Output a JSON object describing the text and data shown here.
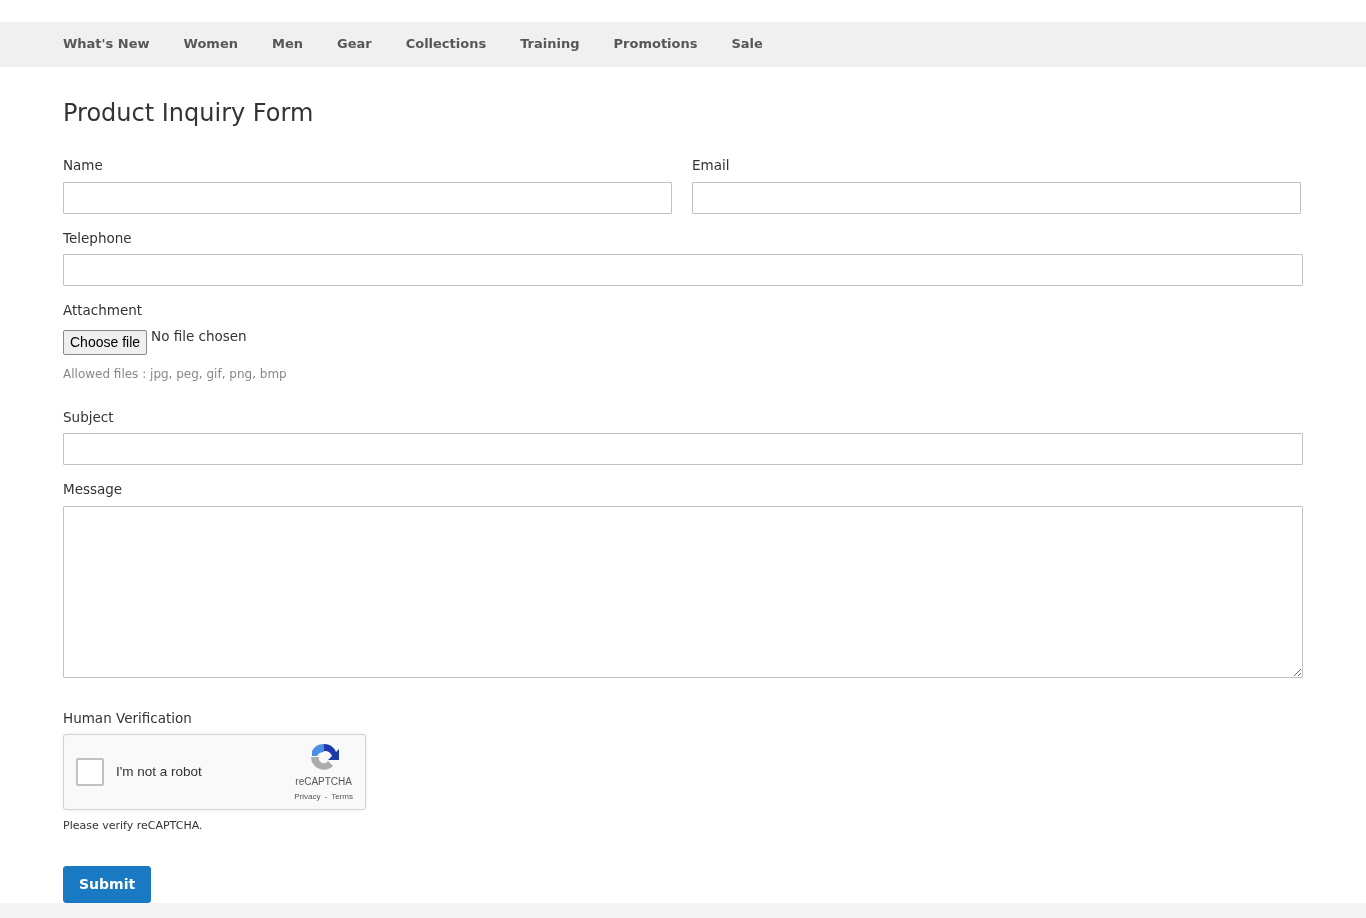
{
  "nav": {
    "items": [
      {
        "label": "What's New"
      },
      {
        "label": "Women"
      },
      {
        "label": "Men"
      },
      {
        "label": "Gear"
      },
      {
        "label": "Collections"
      },
      {
        "label": "Training"
      },
      {
        "label": "Promotions"
      },
      {
        "label": "Sale"
      }
    ]
  },
  "page_title": "Product Inquiry Form",
  "form": {
    "fields": [
      {
        "kind": "text",
        "label": "Name",
        "half": true
      },
      {
        "kind": "text",
        "label": "Email",
        "half": true
      },
      {
        "kind": "text",
        "label": "Telephone"
      },
      {
        "kind": "file",
        "label": "Attachment",
        "button": "Choose file",
        "status": "No file chosen",
        "note": "Allowed files : jpg, peg, gif, png, bmp"
      },
      {
        "kind": "text",
        "label": "Subject"
      },
      {
        "kind": "textarea",
        "label": "Message"
      },
      {
        "kind": "captcha",
        "label": "Human Verification",
        "checkbox_label": "I'm not a robot",
        "checked": false,
        "brand": "reCAPTCHA",
        "privacy": "Privacy",
        "separator": "-",
        "terms": "Terms",
        "note": "Please verify reCAPTCHA."
      }
    ]
  },
  "submit": "Submit"
}
